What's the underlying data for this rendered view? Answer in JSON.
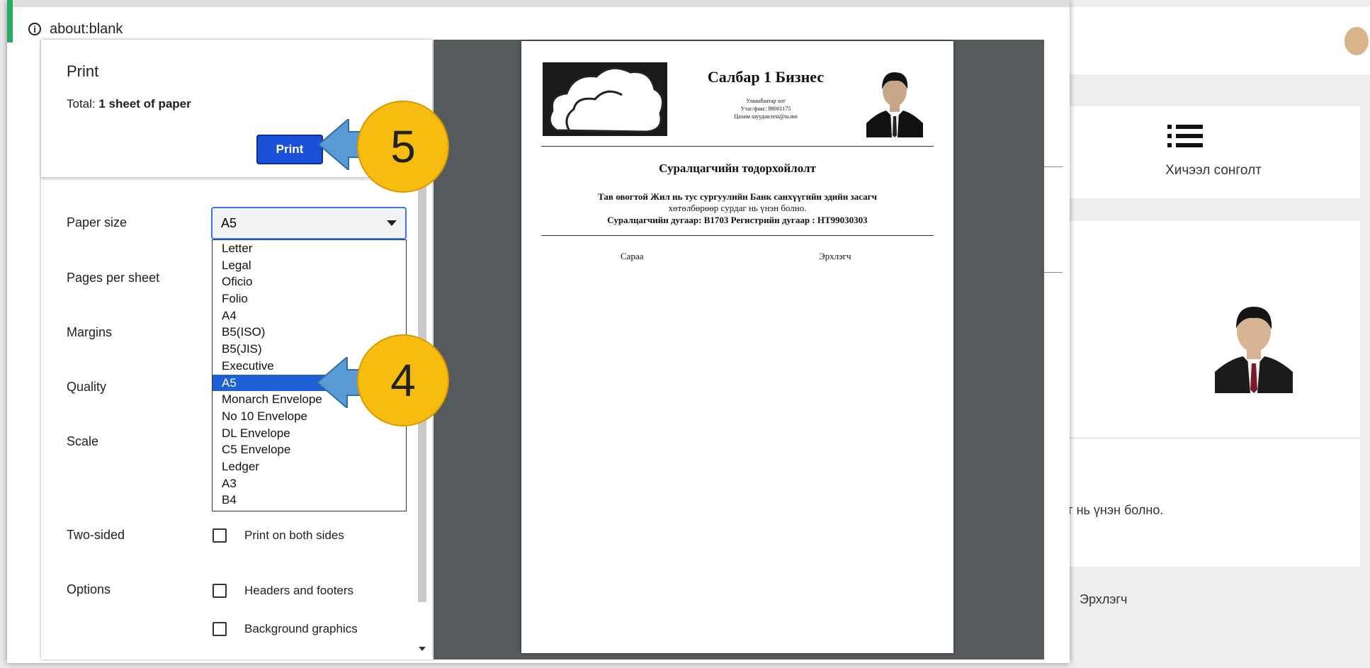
{
  "browser": {
    "address": "about:blank"
  },
  "print_panel": {
    "title": "Print",
    "total_prefix": "Total: ",
    "total_value": "1 sheet of paper",
    "print_button": "Print",
    "labels": {
      "paper_size": "Paper size",
      "pages_per_sheet": "Pages per sheet",
      "margins": "Margins",
      "quality": "Quality",
      "scale": "Scale",
      "two_sided": "Two-sided",
      "options": "Options"
    },
    "paper_size_value": "A5",
    "paper_size_options": [
      "Letter",
      "Legal",
      "Oficio",
      "Folio",
      "A4",
      "B5(ISO)",
      "B5(JIS)",
      "Executive",
      "A5",
      "Monarch Envelope",
      "No 10 Envelope",
      "DL Envelope",
      "C5 Envelope",
      "Ledger",
      "A3",
      "B4"
    ],
    "selected_index": 8,
    "two_sided_option": "Print on both sides",
    "option_headers_footers": "Headers and footers",
    "option_background_graphics": "Background graphics"
  },
  "preview": {
    "company": "Салбар 1 Бизнес",
    "contact_city": "Улаанбаатар хот",
    "contact_phone": "Утас/факс: 88001175",
    "contact_email": "Цахим шуудан:test@tu.mn",
    "doc_title": "Суралцагчийн тодорхойлолт",
    "body_line1": "Тав овогтой Жил нь тус сургуулийн Банк санхүүгийн эдийн засагч",
    "body_line2": "хөтөлбөрөөр сурдаг нь үнэн болно.",
    "body_line3": "Суралцагчийн дугаар: B1703 Регистрийн дугаар : НТ99030303",
    "sign_left": "Сараа",
    "sign_right": "Эрхлэгч"
  },
  "background_app": {
    "card_label": "Хичээл сонголт",
    "partial_text": "г нь үнэн болно.",
    "sign_text": "Эрхлэгч"
  },
  "annotations": {
    "step5": "5",
    "step4": "4",
    "color": "#f6bd10",
    "arrow_color": "#5b9bd5"
  },
  "colors": {
    "print_button": "#1a4fd8",
    "selection": "#1e61d6",
    "preview_bg": "#555a5c"
  }
}
